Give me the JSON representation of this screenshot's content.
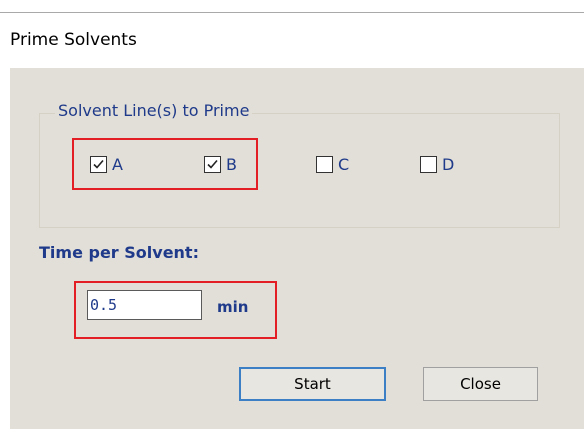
{
  "dialog": {
    "title": "Prime Solvents"
  },
  "solvent_lines": {
    "group_label": "Solvent Line(s) to Prime",
    "items": [
      {
        "label": "A",
        "checked": true
      },
      {
        "label": "B",
        "checked": true
      },
      {
        "label": "C",
        "checked": false
      },
      {
        "label": "D",
        "checked": false
      }
    ]
  },
  "time": {
    "label": "Time per Solvent:",
    "value": "0.5",
    "unit": "min"
  },
  "buttons": {
    "start": "Start",
    "close": "Close"
  },
  "colors": {
    "panel_bg": "#e1dfd7",
    "text_blue": "#1f3a8a",
    "highlight_red": "#e31e24",
    "default_button_border": "#3c7fc4"
  }
}
